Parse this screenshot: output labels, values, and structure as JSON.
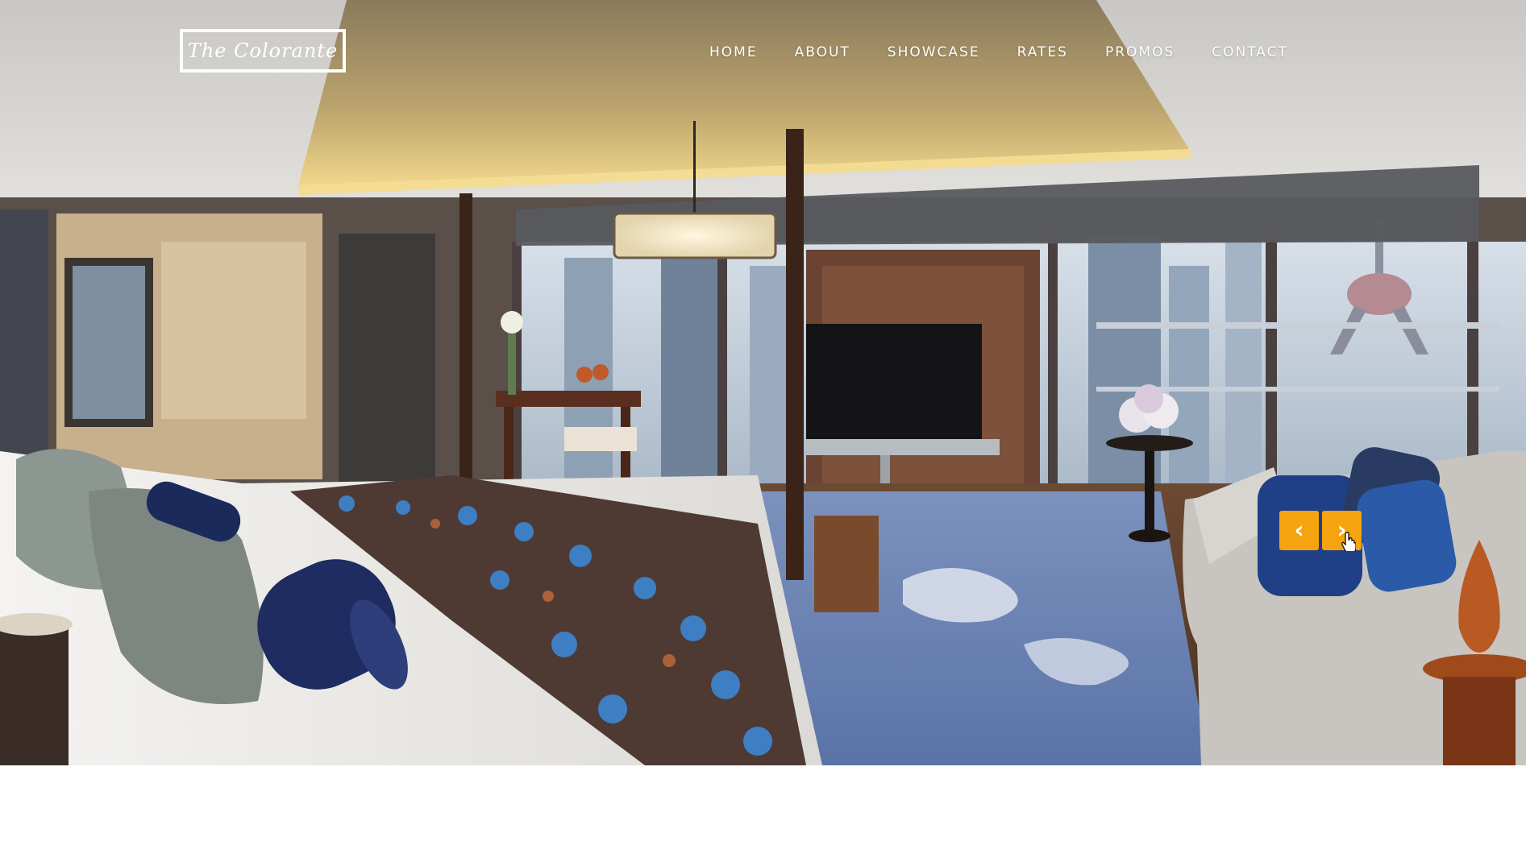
{
  "header": {
    "logo_text": "The Colorante",
    "nav": [
      {
        "label": "HOME"
      },
      {
        "label": "ABOUT"
      },
      {
        "label": "SHOWCASE"
      },
      {
        "label": "RATES"
      },
      {
        "label": "PROMOS"
      },
      {
        "label": "CONTACT"
      }
    ]
  },
  "hero": {
    "image": "luxury-hotel-bedroom-photo",
    "prev_icon": "‹",
    "next_icon": "›"
  },
  "colors": {
    "accent": "#f5a30f",
    "nav_text": "#ffffff",
    "page_background": "#ffffff"
  }
}
